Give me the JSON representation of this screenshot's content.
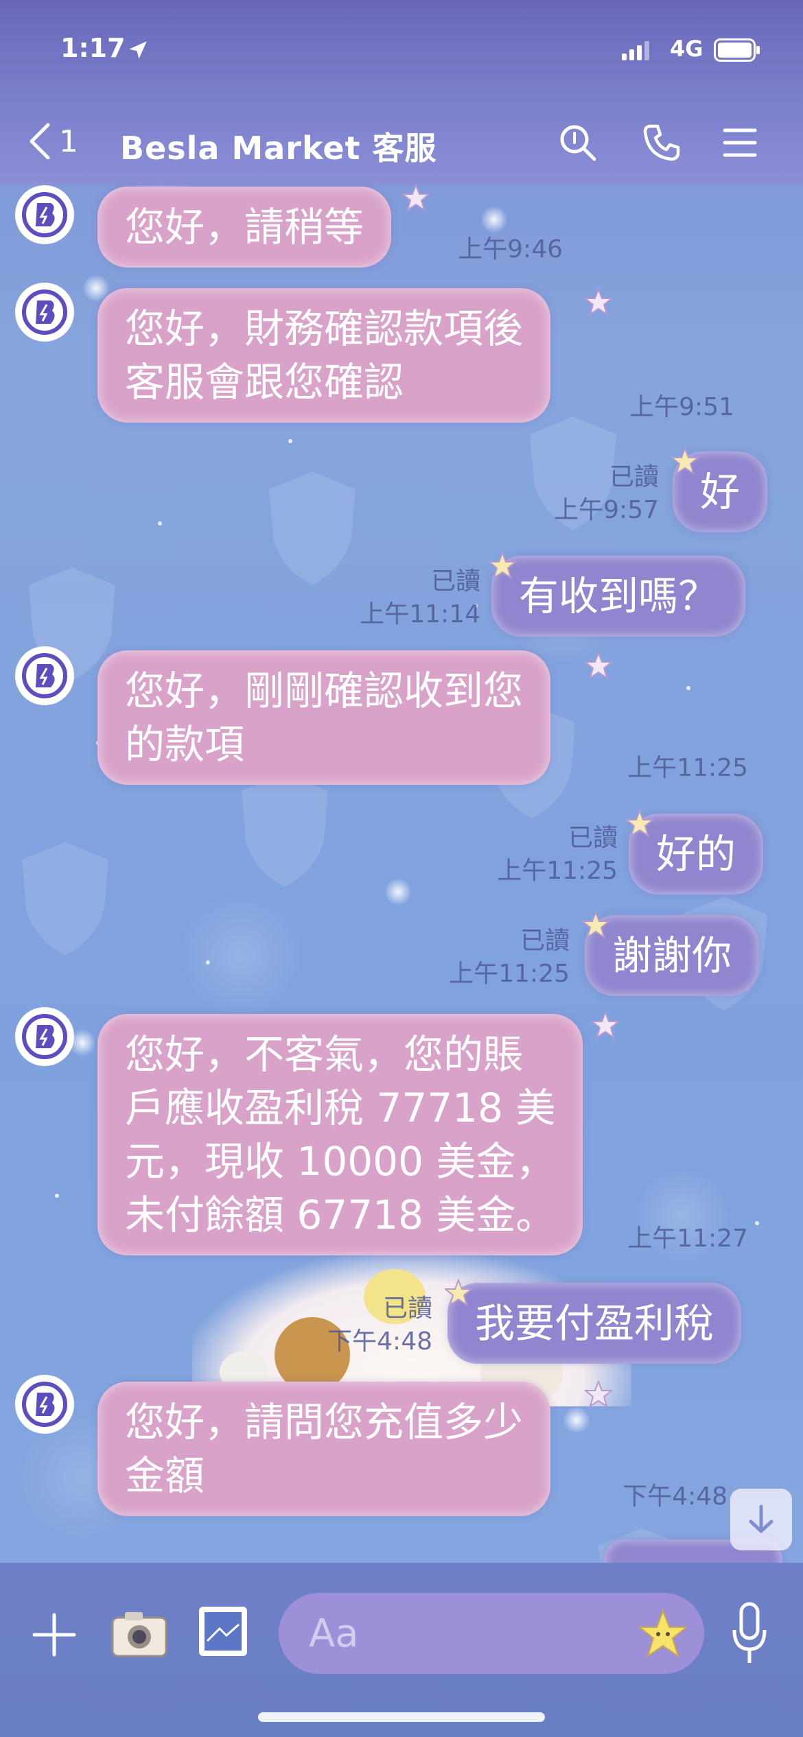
{
  "status_bar": {
    "time": "1:17",
    "network": "4G"
  },
  "header": {
    "back_count": "1",
    "title": "Besla Market 客服"
  },
  "messages": [
    {
      "from": "them",
      "lines": [
        "您好，請稍等"
      ],
      "time": "上午9:46"
    },
    {
      "from": "them",
      "lines": [
        "您好，財務確認款項後",
        "客服會跟您確認"
      ],
      "time": "上午9:51"
    },
    {
      "from": "me",
      "lines": [
        "好"
      ],
      "read": "已讀",
      "time": "上午9:57"
    },
    {
      "from": "me",
      "lines": [
        "有收到嗎？"
      ],
      "read": "已讀",
      "time": "上午11:14"
    },
    {
      "from": "them",
      "lines": [
        "您好，剛剛確認收到您",
        "的款項"
      ],
      "time": "上午11:25"
    },
    {
      "from": "me",
      "lines": [
        "好的"
      ],
      "read": "已讀",
      "time": "上午11:25"
    },
    {
      "from": "me",
      "lines": [
        "謝謝你"
      ],
      "read": "已讀",
      "time": "上午11:25"
    },
    {
      "from": "them",
      "lines": [
        "您好，不客氣，您的賬",
        "戶應收盈利稅 77718 美",
        "元，現收 10000 美金，",
        "未付餘額 67718 美金。"
      ],
      "time": "上午11:27"
    },
    {
      "from": "me",
      "lines": [
        "我要付盈利稅"
      ],
      "read": "已讀",
      "time": "下午4:48"
    },
    {
      "from": "them",
      "lines": [
        "您好，請問您充值多少",
        "金額"
      ],
      "time": "下午4:48"
    }
  ],
  "input": {
    "placeholder": "Aa"
  },
  "colors": {
    "incoming_bubble": "#d9a3c9",
    "outgoing_bubble": "#8f86cf",
    "background": "#7f9bd6"
  },
  "icons": [
    "location-arrow-icon",
    "signal-bars-icon",
    "battery-icon",
    "chevron-left-icon",
    "search-icon",
    "phone-icon",
    "menu-icon",
    "plus-icon",
    "camera-icon",
    "image-icon",
    "emoji-icon",
    "microphone-icon",
    "arrow-down-icon"
  ]
}
